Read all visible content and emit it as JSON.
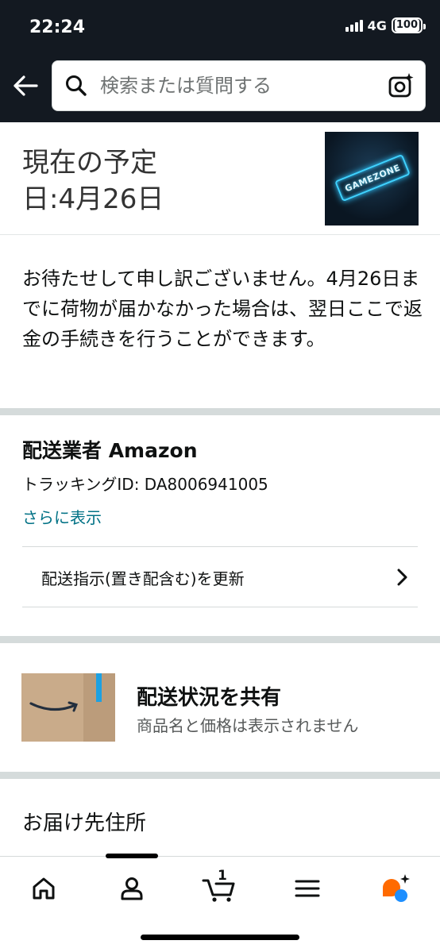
{
  "status_bar": {
    "time": "22:24",
    "network": "4G",
    "battery": "100"
  },
  "header": {
    "search_placeholder": "検索または質問する",
    "icons": [
      "back-arrow-icon",
      "search-icon",
      "camera-icon"
    ],
    "bg_color": "#131921"
  },
  "estimate": {
    "line1": "現在の予定",
    "line2": "日:4月26日",
    "thumbnail_text": "GAMEZONE"
  },
  "apology": {
    "text": "お待たせして申し訳ございません。4月26日までに荷物が届かなかった場合は、翌日ここで返金の手続きを行うことができます。"
  },
  "carrier": {
    "title": "配送業者 Amazon",
    "tracking": "トラッキングID: DA8006941005",
    "more_link": "さらに表示",
    "update_instructions": "配送指示(置き配含む)を更新"
  },
  "share": {
    "title": "配送状況を共有",
    "subtitle": "商品名と価格は表示されません"
  },
  "address": {
    "title": "お届け先住所"
  },
  "bottom_nav": {
    "items": [
      "home-icon",
      "account-icon",
      "cart-icon",
      "menu-icon",
      "rufus-icon"
    ],
    "cart_count": "1"
  },
  "colors": {
    "link": "#007185",
    "text": "#0f1111",
    "separator": "#d5dbdb"
  }
}
